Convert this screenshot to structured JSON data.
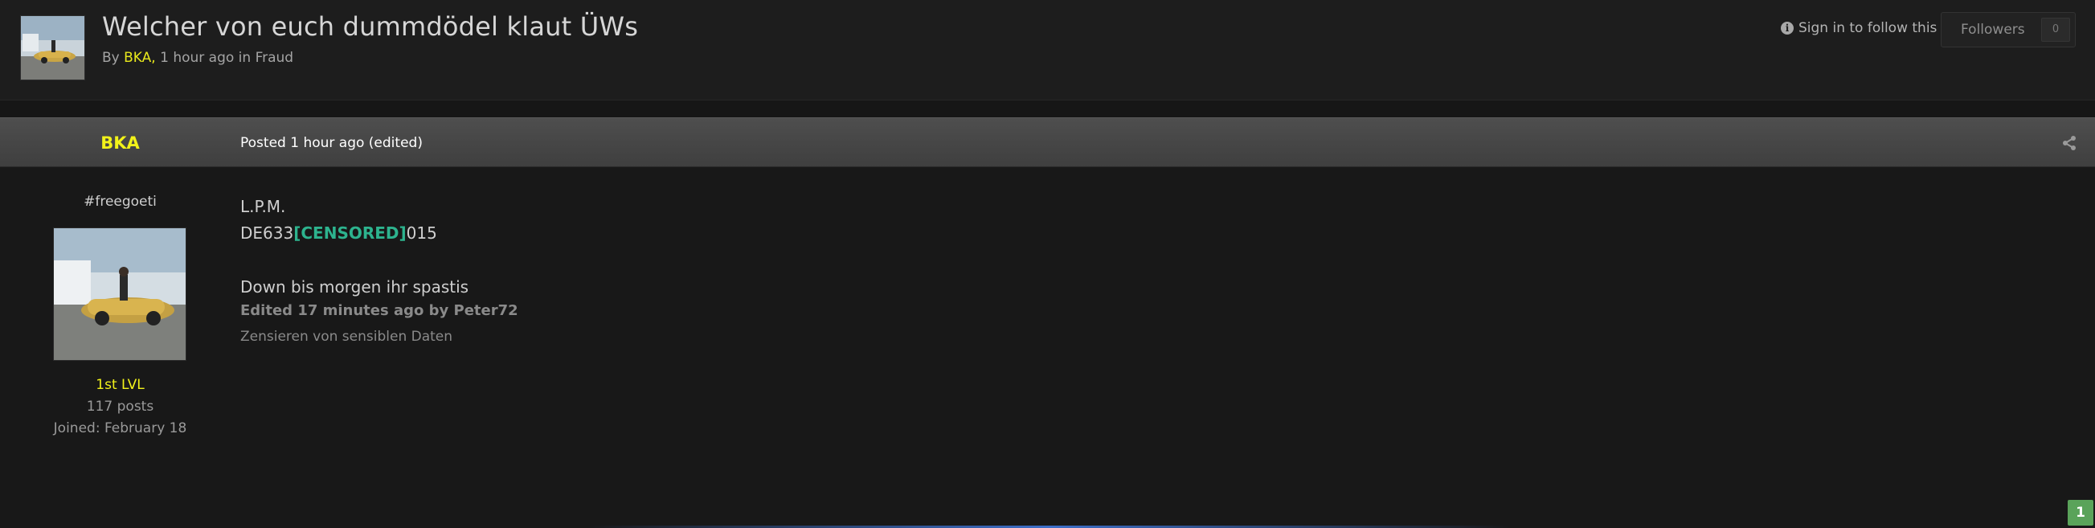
{
  "topic": {
    "title": "Welcher von euch dummdödel klaut ÜWs",
    "by_label": "By",
    "author": "BKA",
    "comma": ",",
    "time_and_forum": "1 hour ago in Fraud",
    "sign_in_follow": "Sign in to follow this",
    "followers_label": "Followers",
    "followers_count": "0"
  },
  "post": {
    "author_name": "BKA",
    "posted_label": "Posted 1 hour ago (edited)",
    "author_title": "#freegoeti",
    "author_rank": "1st LVL",
    "author_posts": "117 posts",
    "author_joined": "Joined: February 18",
    "content": {
      "line1": "L.P.M.",
      "iban_prefix": "DE633",
      "censored": "[CENSORED]",
      "iban_suffix": "015",
      "line3": "Down bis morgen ihr spastis"
    },
    "edited_note": "Edited 17 minutes ago by Peter72",
    "edit_reason": "Zensieren von sensiblen Daten"
  },
  "pagination": {
    "current_page": "1"
  },
  "colors": {
    "background": "#161616",
    "header_bg": "#1d1d1d",
    "post_bar": "#474747",
    "author_highlight": "#f2f21a",
    "censored_accent": "#2db38e",
    "page_badge": "#5aa35a"
  },
  "icons": {
    "info": "info-circle-icon",
    "share": "share-icon"
  }
}
